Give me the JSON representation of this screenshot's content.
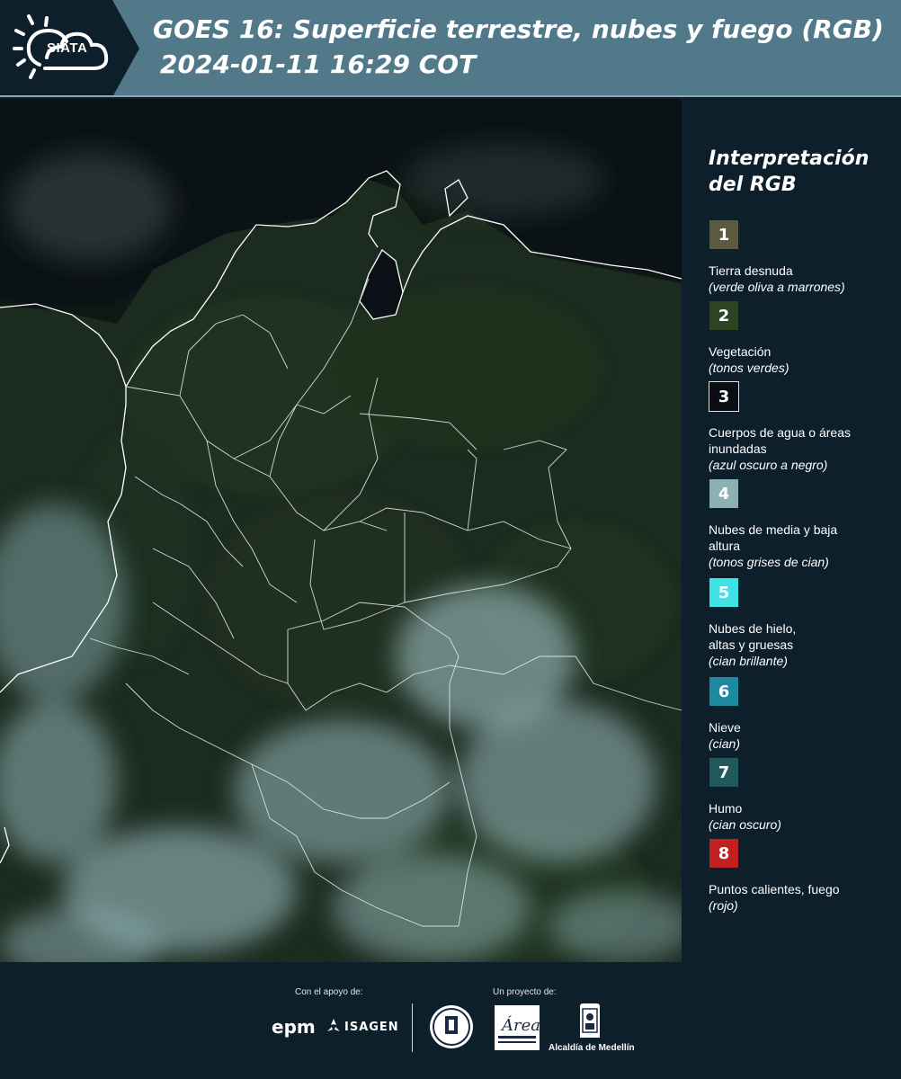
{
  "header": {
    "logo_text": "SIATA",
    "title_line1": "GOES 16: Superficie terrestre, nubes y fuego (RGB)",
    "title_line2": "2024-01-11 16:29 COT"
  },
  "legend": {
    "title_line1": "Interpretación",
    "title_line2": "del RGB",
    "items": [
      {
        "number": "1",
        "label": "Tierra desnuda",
        "sub": "(verde oliva a marrones)",
        "color": "#5c5a3c"
      },
      {
        "number": "2",
        "label": "Vegetación",
        "sub": "(tonos verdes)",
        "color": "#2e4422"
      },
      {
        "number": "3",
        "label": "Cuerpos de agua o áreas inundadas",
        "sub": "(azul oscuro a negro)",
        "color": "#0a0e14"
      },
      {
        "number": "4",
        "label": "Nubes de media y baja altura",
        "sub": "(tonos grises de cian)",
        "color": "#8bb1b0"
      },
      {
        "number": "5",
        "label": "Nubes de hielo, altas y gruesas",
        "sub": "(cian brillante)",
        "color": "#3fe3e6"
      },
      {
        "number": "6",
        "label": "Nieve",
        "sub": "(cian)",
        "color": "#1d8aa1"
      },
      {
        "number": "7",
        "label": "Humo",
        "sub": "(cian oscuro)",
        "color": "#215a5b"
      },
      {
        "number": "8",
        "label": "Puntos calientes, fuego",
        "sub": "(rojo)",
        "color": "#c21f1f"
      }
    ]
  },
  "footer": {
    "support_caption": "Con el apoyo de:",
    "project_caption": "Un proyecto de:",
    "sponsor1": "epm",
    "sponsor2": "ISAGEN",
    "partner1": "Área Metropolitana",
    "partner2": "Alcaldía de Medellín"
  }
}
